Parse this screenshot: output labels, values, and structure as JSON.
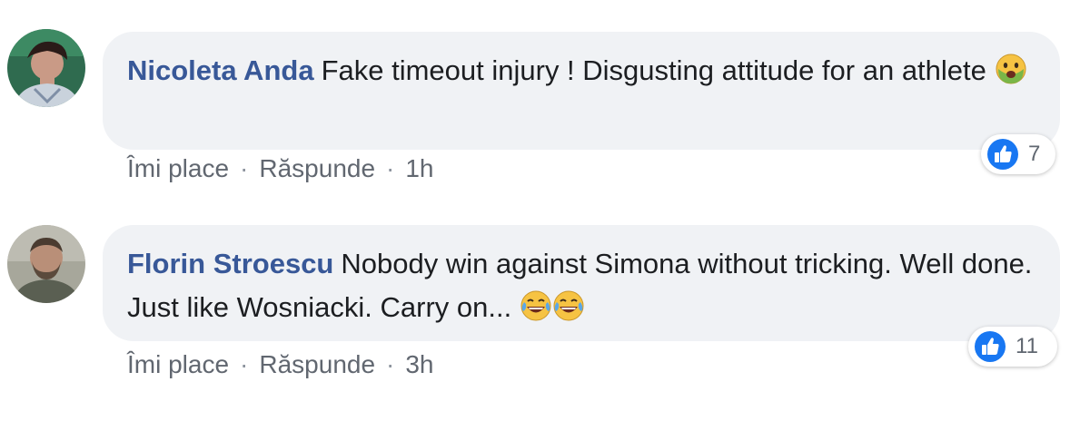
{
  "comments": [
    {
      "author": "Nicoleta Anda",
      "text": "Fake timeout injury ! Disgusting attitude for an athlete",
      "emojis": [
        "nauseated-face"
      ],
      "reaction": {
        "icon": "like-icon",
        "count": "7"
      },
      "actions": {
        "like": "Îmi place",
        "reply": "Răspunde",
        "time": "1h",
        "separator": "·"
      }
    },
    {
      "author": "Florin Stroescu",
      "text": "Nobody win against Simona without tricking. Well done. Just like Wosniacki. Carry on...",
      "emojis": [
        "tears-of-joy-face",
        "tears-of-joy-face"
      ],
      "reaction": {
        "icon": "like-icon",
        "count": "11"
      },
      "actions": {
        "like": "Îmi place",
        "reply": "Răspunde",
        "time": "3h",
        "separator": "·"
      }
    }
  ],
  "colors": {
    "bubble": "#f0f2f5",
    "author": "#385898",
    "text": "#1c1e21",
    "meta": "#616770",
    "like": "#1877f2"
  }
}
